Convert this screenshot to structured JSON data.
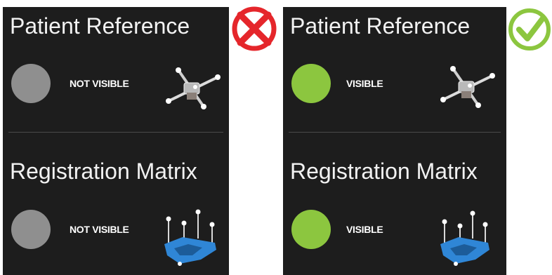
{
  "left_panel": {
    "badge_icon": "red-x-icon",
    "patient_reference": {
      "title": "Patient Reference",
      "status": "NOT VISIBLE",
      "indicator_color": "#8f8f8f"
    },
    "registration_matrix": {
      "title": "Registration Matrix",
      "status": "NOT VISIBLE",
      "indicator_color": "#8f8f8f"
    }
  },
  "right_panel": {
    "badge_icon": "green-check-icon",
    "patient_reference": {
      "title": "Patient Reference",
      "status": "VISIBLE",
      "indicator_color": "#8cc63f"
    },
    "registration_matrix": {
      "title": "Registration Matrix",
      "status": "VISIBLE",
      "indicator_color": "#8cc63f"
    }
  },
  "colors": {
    "panel_bg": "#1d1d1d",
    "x_red": "#e5262b",
    "check_green": "#8cc63f",
    "matrix_blue": "#2f86d6"
  }
}
